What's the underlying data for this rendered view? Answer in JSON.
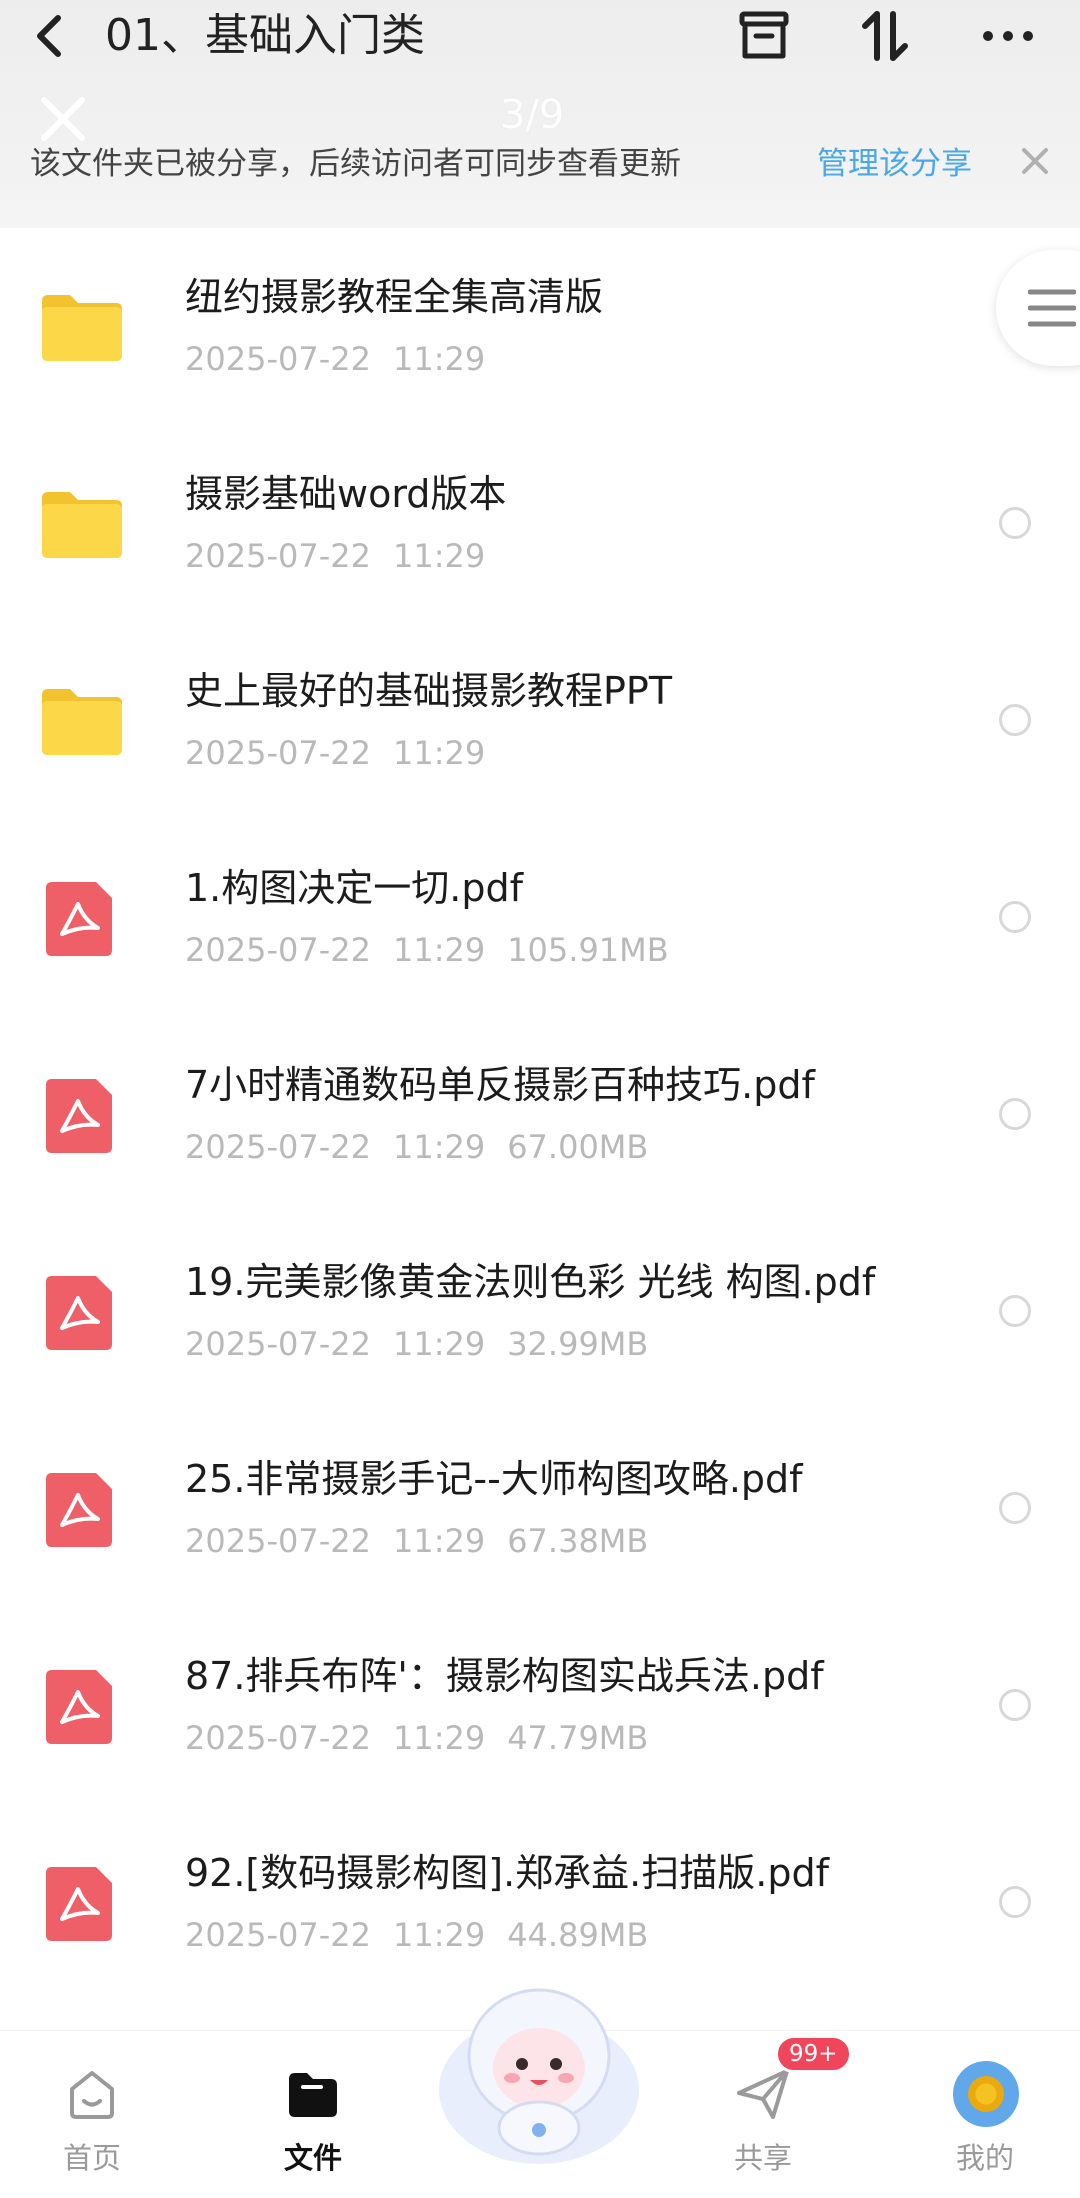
{
  "header": {
    "title": "01、基础入门类",
    "counter": "3/9"
  },
  "share_banner": {
    "text": "该文件夹已被分享，后续访问者可同步查看更新",
    "manage_label": "管理该分享"
  },
  "files": [
    {
      "type": "folder",
      "name": "纽约摄影教程全集高清版",
      "date": "2025-07-22",
      "time": "11:29",
      "size": ""
    },
    {
      "type": "folder",
      "name": "摄影基础word版本",
      "date": "2025-07-22",
      "time": "11:29",
      "size": ""
    },
    {
      "type": "folder",
      "name": "史上最好的基础摄影教程PPT",
      "date": "2025-07-22",
      "time": "11:29",
      "size": ""
    },
    {
      "type": "pdf",
      "name": "1.构图决定一切.pdf",
      "date": "2025-07-22",
      "time": "11:29",
      "size": "105.91MB"
    },
    {
      "type": "pdf",
      "name": "7小时精通数码单反摄影百种技巧.pdf",
      "date": "2025-07-22",
      "time": "11:29",
      "size": "67.00MB"
    },
    {
      "type": "pdf",
      "name": "19.完美影像黄金法则色彩 光线 构图.pdf",
      "date": "2025-07-22",
      "time": "11:29",
      "size": "32.99MB"
    },
    {
      "type": "pdf",
      "name": "25.非常摄影手记--大师构图攻略.pdf",
      "date": "2025-07-22",
      "time": "11:29",
      "size": "67.38MB"
    },
    {
      "type": "pdf",
      "name": "87.排兵布阵'：摄影构图实战兵法.pdf",
      "date": "2025-07-22",
      "time": "11:29",
      "size": "47.79MB"
    },
    {
      "type": "pdf",
      "name": "92.[数码摄影构图].郑承益.扫描版.pdf",
      "date": "2025-07-22",
      "time": "11:29",
      "size": "44.89MB"
    }
  ],
  "tabs": {
    "home": "首页",
    "files": "文件",
    "share": "共享",
    "me": "我的",
    "share_badge": "99+"
  },
  "colors": {
    "accent": "#4aa8e8",
    "folder": "#fcd748",
    "pdf": "#ee5f67",
    "badge": "#f0455a"
  }
}
